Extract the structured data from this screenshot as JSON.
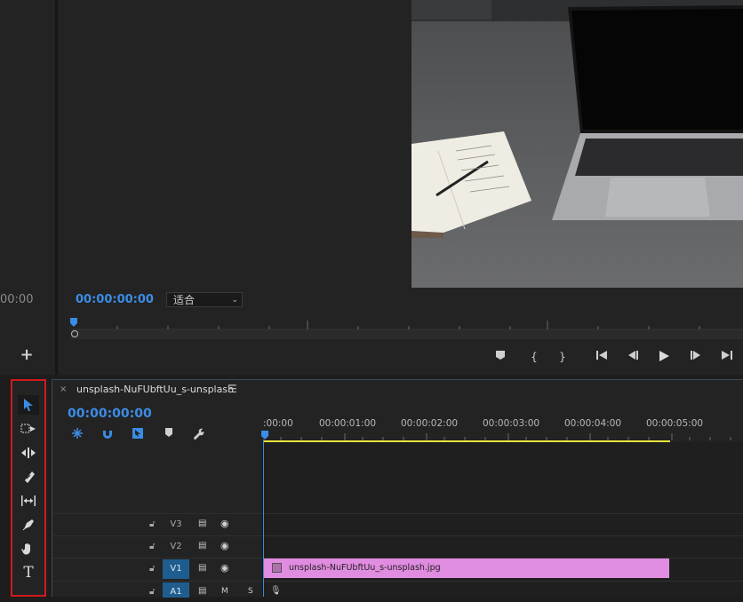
{
  "source": {
    "timecode": "00:00",
    "add_button": "+"
  },
  "program": {
    "timecode": "00:00:00:00",
    "zoom": {
      "selected": "适合"
    },
    "transport": {
      "marker": "marker-icon",
      "mark_in": "{",
      "mark_out": "}",
      "go_to_in": "go-to-in-icon",
      "step_back": "step-back-icon",
      "play": "play-icon",
      "step_forward": "step-forward-icon",
      "go_to_out": "go-to-out-icon"
    }
  },
  "tools": [
    {
      "name": "selection-tool",
      "glyph": "➤"
    },
    {
      "name": "track-select-tool",
      "glyph": "⬚"
    },
    {
      "name": "ripple-edit-tool",
      "glyph": "⇹"
    },
    {
      "name": "razor-tool",
      "glyph": "⌁"
    },
    {
      "name": "slip-tool",
      "glyph": "↔"
    },
    {
      "name": "pen-tool",
      "glyph": "✒"
    },
    {
      "name": "hand-tool",
      "glyph": "✋"
    },
    {
      "name": "type-tool",
      "glyph": "T"
    }
  ],
  "timeline": {
    "close": "×",
    "sequence_name": "unsplash-NuFUbftUu_s-unsplash",
    "menu": "☰",
    "timecode": "00:00:00:00",
    "ruler_labels": [
      ":00:00",
      "00:00:01:00",
      "00:00:02:00",
      "00:00:03:00",
      "00:00:04:00",
      "00:00:05:00"
    ],
    "tracks": [
      {
        "label": "V3",
        "active": false
      },
      {
        "label": "V2",
        "active": false
      },
      {
        "label": "V1",
        "active": true
      },
      {
        "label": "A1",
        "active": true
      }
    ],
    "clip": {
      "name": "unsplash-NuFUbftUu_s-unsplash.jpg",
      "color": "#e08ce0"
    }
  },
  "colors": {
    "accent": "#3b8ce6",
    "highlight_border": "#d11a1a",
    "work_area": "#e8e33a"
  }
}
